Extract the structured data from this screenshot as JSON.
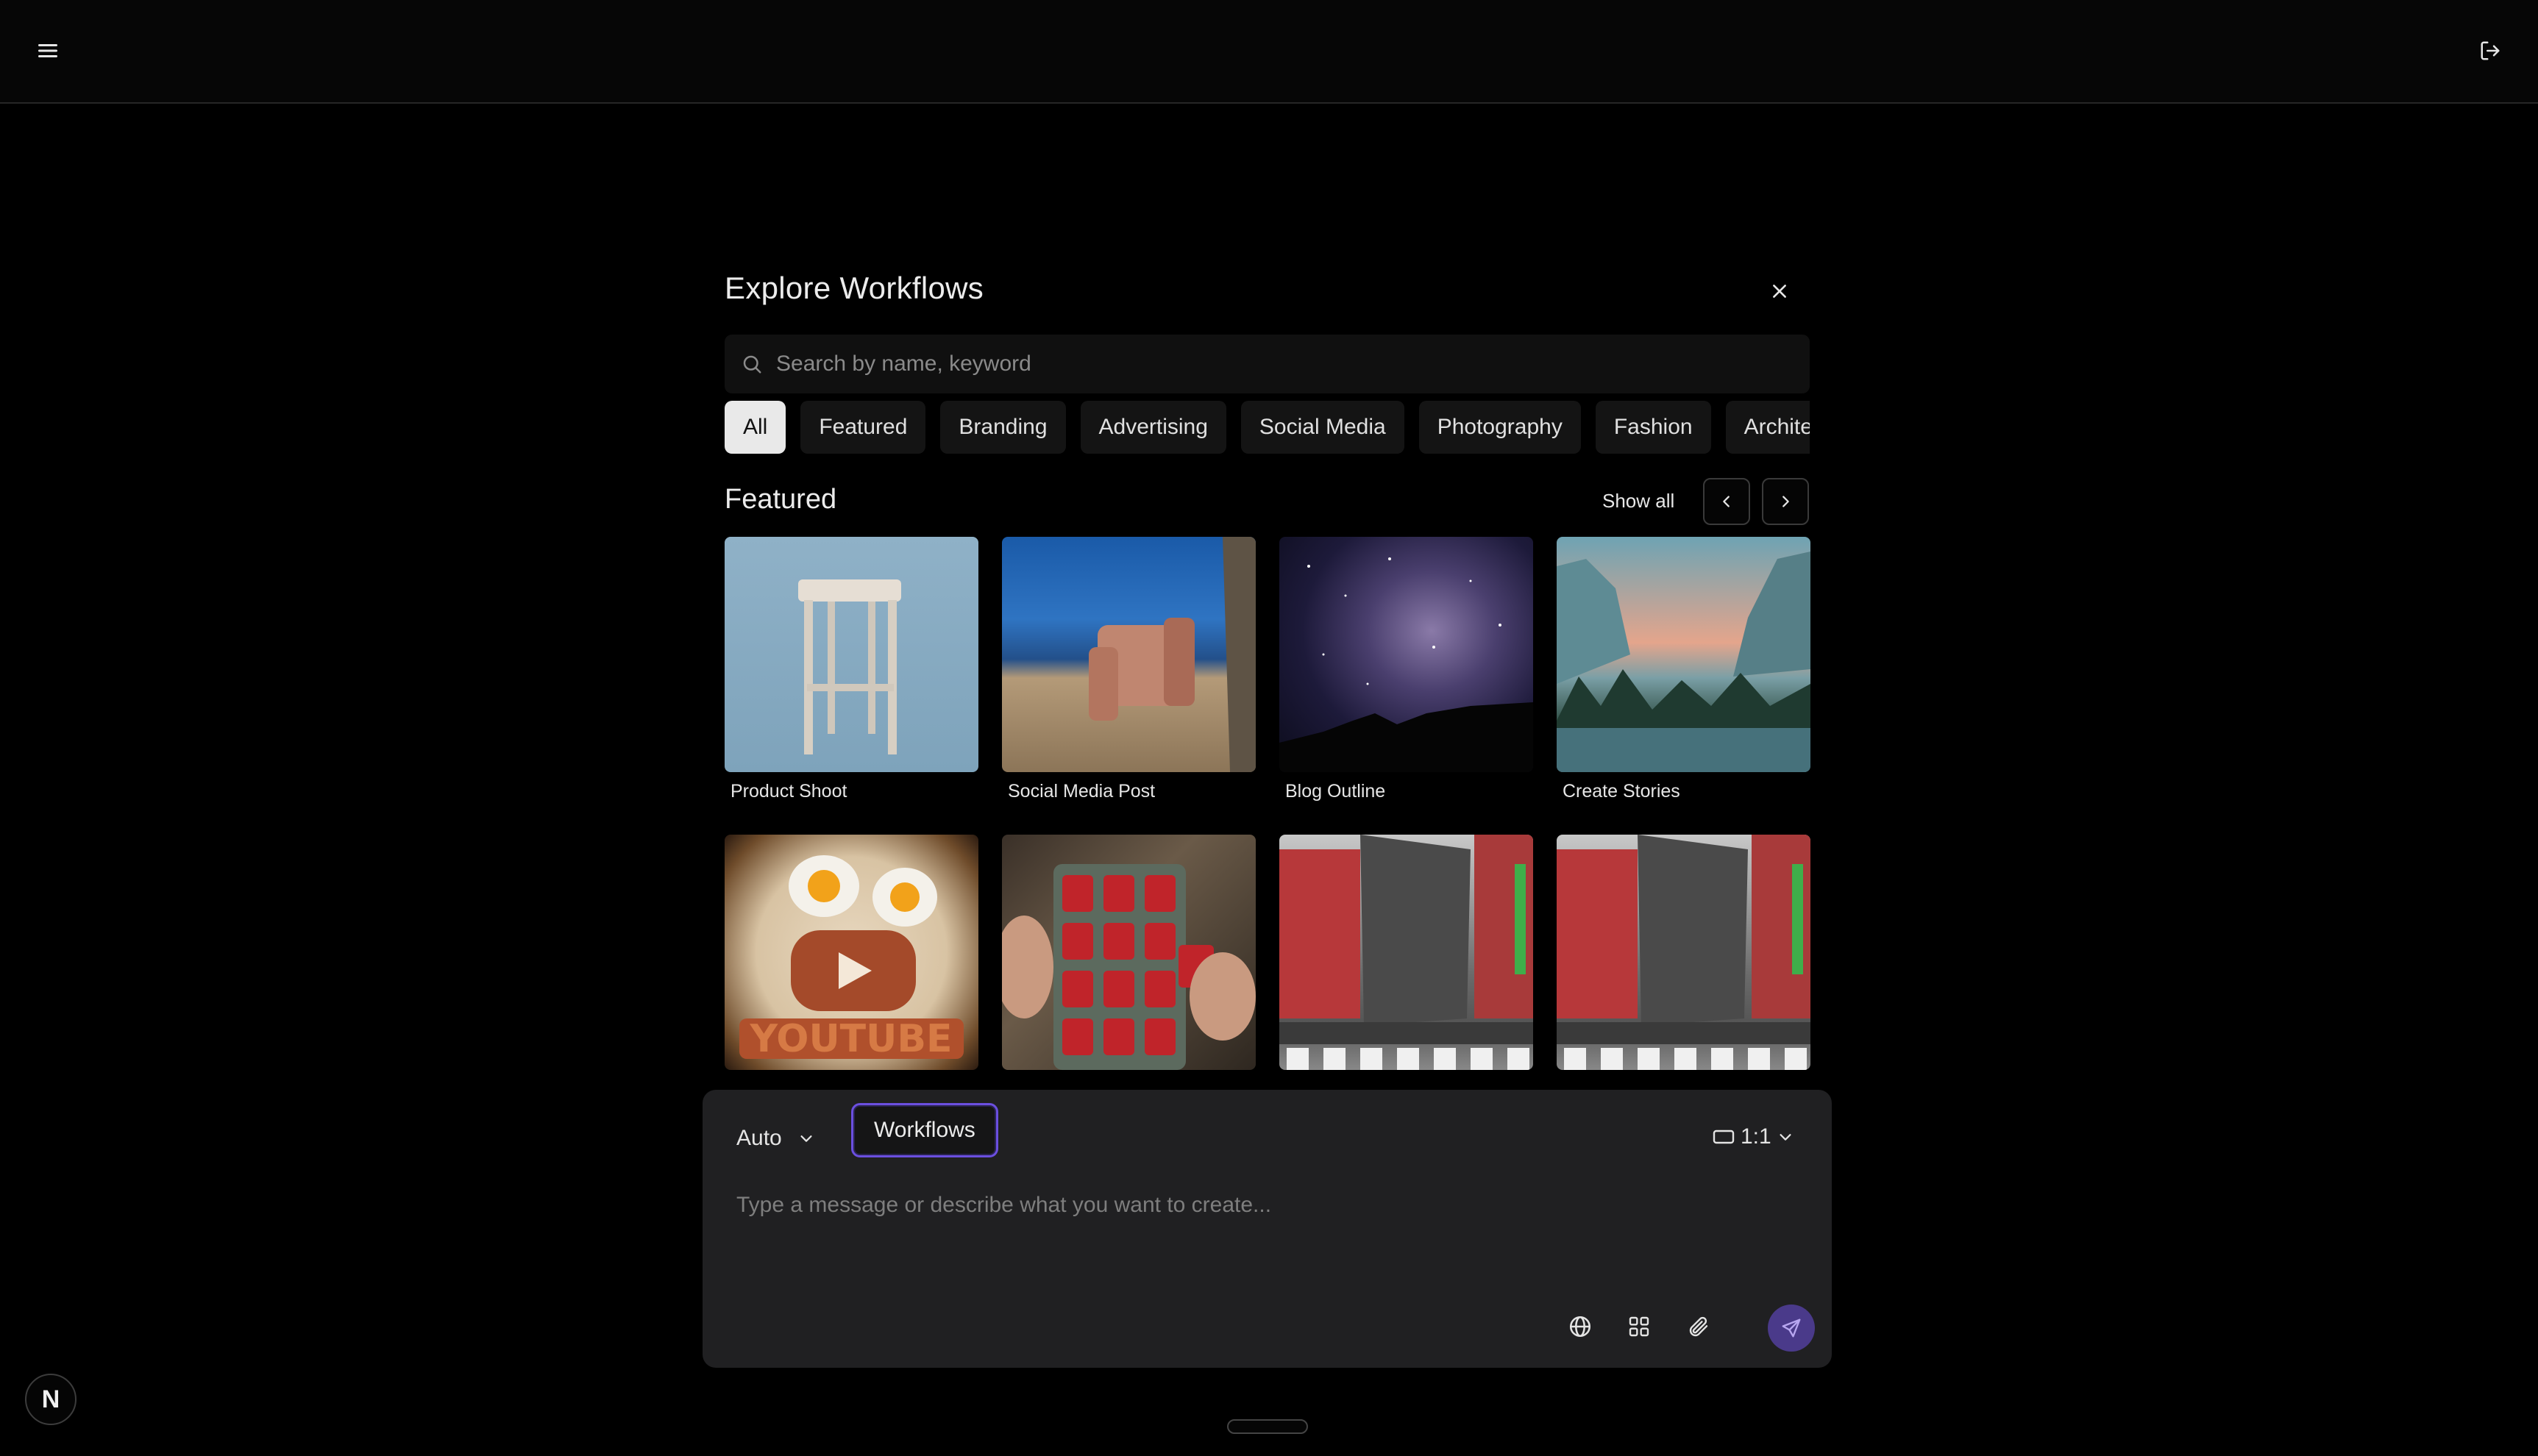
{
  "header": {
    "menu_icon": "hamburger-menu-icon",
    "logout_icon": "logout-icon"
  },
  "dialog": {
    "title": "Explore Workflows",
    "close_icon": "close-icon",
    "search": {
      "placeholder": "Search by name, keyword",
      "value": ""
    },
    "tabs": [
      {
        "label": "All",
        "active": true
      },
      {
        "label": "Featured"
      },
      {
        "label": "Branding"
      },
      {
        "label": "Advertising"
      },
      {
        "label": "Social Media"
      },
      {
        "label": "Photography"
      },
      {
        "label": "Fashion"
      },
      {
        "label": "Architecture"
      }
    ],
    "section": {
      "title": "Featured",
      "show_all": "Show all"
    },
    "cards": [
      {
        "label": "Product Shoot",
        "thumb": "stool"
      },
      {
        "label": "Social Media Post",
        "thumb": "chair"
      },
      {
        "label": "Blog Outline",
        "thumb": "sky"
      },
      {
        "label": "Create Stories",
        "thumb": "valley"
      },
      {
        "label": "",
        "thumb": "food"
      },
      {
        "label": "",
        "thumb": "cans"
      },
      {
        "label": "",
        "thumb": "city"
      },
      {
        "label": "",
        "thumb": "city"
      }
    ]
  },
  "composer": {
    "model": "Auto",
    "workflows_label": "Workflows",
    "ratio": "1:1",
    "placeholder": "Type a message or describe what you want to create...",
    "accent_color": "#6b4fe0"
  },
  "avatar": {
    "initial": "N"
  }
}
